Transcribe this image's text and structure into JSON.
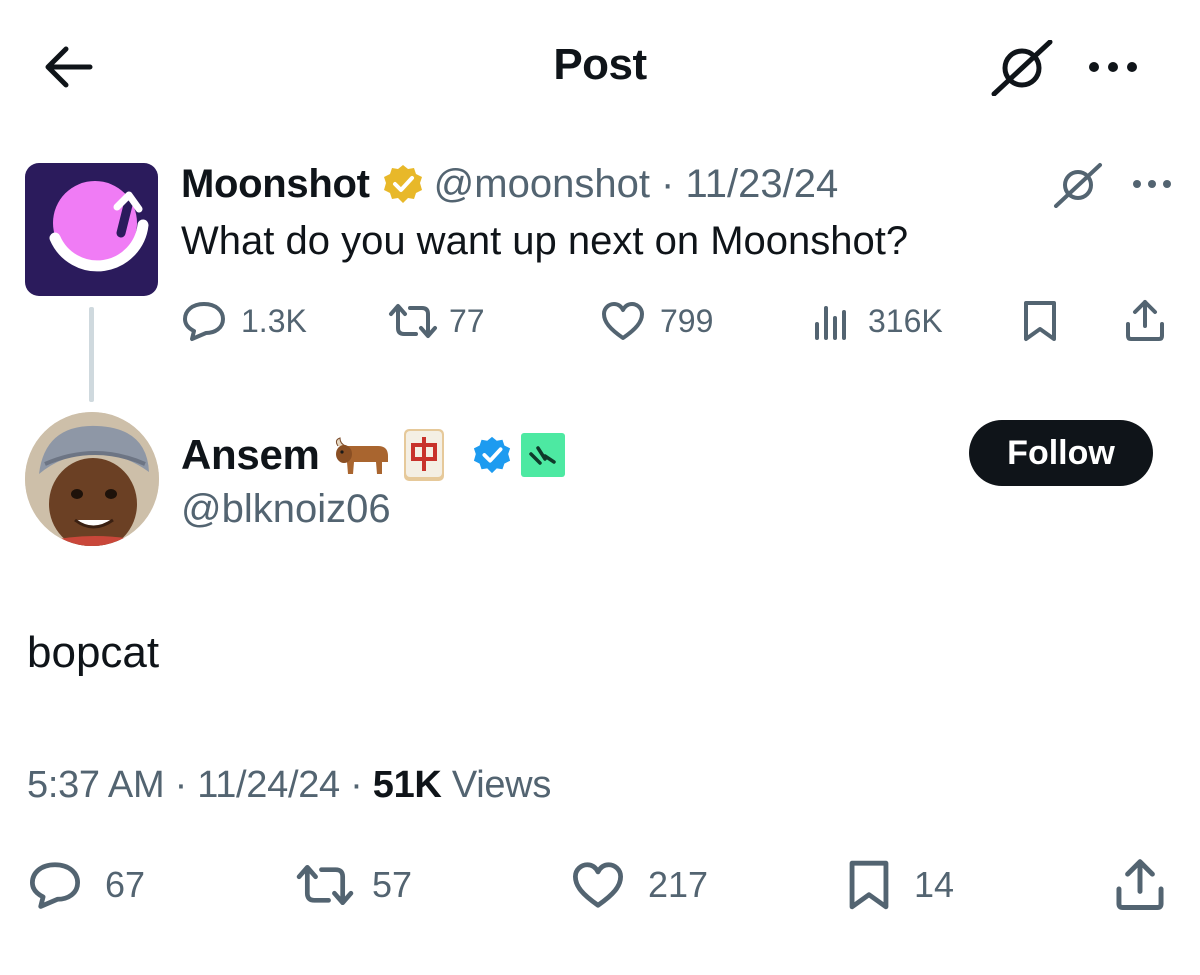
{
  "header": {
    "title": "Post"
  },
  "parent_post": {
    "author_name": "Moonshot",
    "handle_date": "@moonshot · 11/23/24",
    "text": "What do you want up next on Moonshot?",
    "stats": {
      "replies": "1.3K",
      "reposts": "77",
      "likes": "799",
      "views": "316K"
    }
  },
  "reply": {
    "author_name": "Ansem",
    "emoji": "🐂 🀄",
    "handle": "@blknoiz06",
    "follow_label": "Follow",
    "text": "bopcat",
    "time_date": "5:37 AM · 11/24/24 · ",
    "views_count": "51K",
    "views_label": "Views",
    "stats": {
      "replies": "67",
      "reposts": "57",
      "likes": "217",
      "bookmarks": "14"
    }
  },
  "colors": {
    "text": "#0f1419",
    "muted": "#536471",
    "verified_blue": "#1d9bf0",
    "gold": "#e8b829",
    "moonshot_bg": "#2b1b5c",
    "moonshot_pink": "#f07cf5",
    "affiliate_green": "#4de9a2"
  },
  "icons": [
    "back-arrow-icon",
    "grok-icon",
    "more-icon",
    "gold-checkmark-icon",
    "blue-checkmark-icon",
    "reply-icon",
    "repost-icon",
    "like-icon",
    "views-icon",
    "bookmark-icon",
    "share-icon",
    "bull-emoji-icon",
    "mahjong-dragon-icon",
    "affiliate-badge-icon"
  ]
}
